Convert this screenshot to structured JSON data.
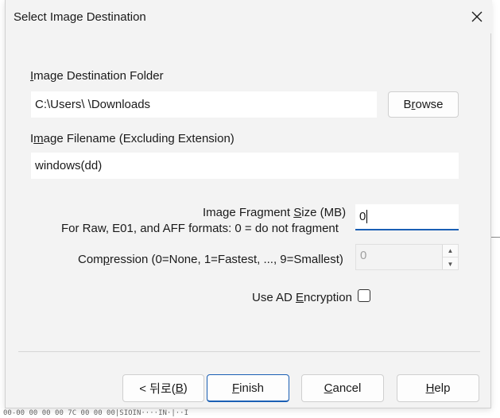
{
  "dialog": {
    "title": "Select Image Destination",
    "close_icon": "close-icon"
  },
  "destination_folder": {
    "label_prefix": "",
    "label_mnemonic": "I",
    "label_rest": "mage Destination Folder",
    "value": "C:\\Users\\            \\Downloads",
    "browse_prefix": "B",
    "browse_mnemonic": "r",
    "browse_rest": "owse"
  },
  "filename": {
    "label_prefix": "I",
    "label_mnemonic": "m",
    "label_rest": "age Filename (Excluding Extension)",
    "value": "windows(dd)"
  },
  "fragment": {
    "label_prefix": "Image Fragment ",
    "label_mnemonic": "S",
    "label_rest": "ize (MB)",
    "sublabel": "For Raw, E01, and AFF formats: 0 = do not fragment",
    "value": "0"
  },
  "compression": {
    "label_prefix": "Com",
    "label_mnemonic": "p",
    "label_rest": "ression (0=None, 1=Fastest, ..., 9=Smallest)",
    "value": "0",
    "up_icon": "spin-up-icon",
    "down_icon": "spin-down-icon"
  },
  "encryption": {
    "label_prefix": "Use AD ",
    "label_mnemonic": "E",
    "label_rest": "ncryption",
    "checked": false
  },
  "buttons": {
    "back_prefix": "< 뒤로(",
    "back_mnemonic": "B",
    "back_suffix": ")",
    "finish_mnemonic": "F",
    "finish_rest": "inish",
    "cancel_mnemonic": "C",
    "cancel_rest": "ancel",
    "help_mnemonic": "H",
    "help_rest": "elp"
  },
  "background": {
    "bottom_text": "00-00 00 00 00 7C 00 00 00|SIOIN····IN·|··I"
  }
}
